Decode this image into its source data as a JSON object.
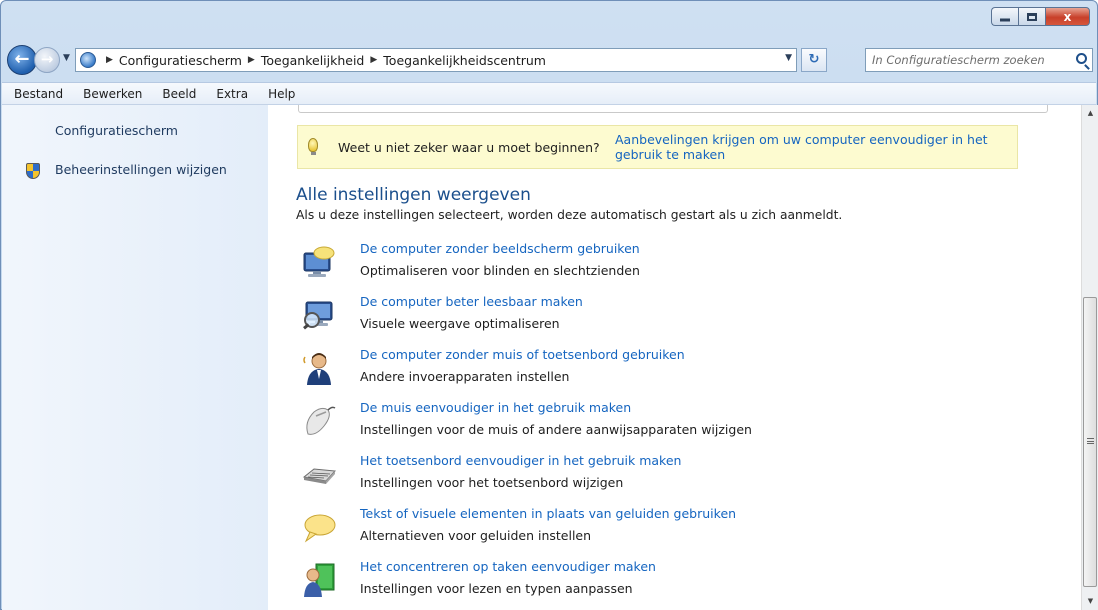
{
  "window": {
    "controls": {
      "minimize": "",
      "maximize": "",
      "close": "x"
    }
  },
  "navigation": {
    "back_glyph": "←",
    "forward_glyph": "→",
    "breadcrumbs": [
      "Configuratiescherm",
      "Toegankelijkheid",
      "Toegankelijkheidscentrum"
    ],
    "search_placeholder": "In Configuratiescherm zoeken"
  },
  "menubar": {
    "items": [
      "Bestand",
      "Bewerken",
      "Beeld",
      "Extra",
      "Help"
    ]
  },
  "sidebar": {
    "home_link": "Configuratiescherm",
    "admin_link": "Beheerinstellingen wijzigen"
  },
  "tip": {
    "question": "Weet u niet zeker waar u moet beginnen?",
    "link": "Aanbevelingen krijgen om uw computer eenvoudiger in het gebruik te maken"
  },
  "section": {
    "title": "Alle instellingen weergeven",
    "subtitle": "Als u deze instellingen selecteert, worden deze automatisch gestart als u zich aanmeldt."
  },
  "items": [
    {
      "title": "De computer zonder beeldscherm gebruiken",
      "desc": "Optimaliseren voor blinden en slechtzienden",
      "icon": "monitor-speech-icon"
    },
    {
      "title": "De computer beter leesbaar maken",
      "desc": "Visuele weergave optimaliseren",
      "icon": "monitor-magnifier-icon"
    },
    {
      "title": "De computer zonder muis of toetsenbord gebruiken",
      "desc": "Andere invoerapparaten instellen",
      "icon": "person-speech-icon"
    },
    {
      "title": "De muis eenvoudiger in het gebruik maken",
      "desc": "Instellingen voor de muis of andere aanwijsapparaten wijzigen",
      "icon": "mouse-icon"
    },
    {
      "title": "Het toetsenbord eenvoudiger in het gebruik maken",
      "desc": "Instellingen voor het toetsenbord wijzigen",
      "icon": "keyboard-icon"
    },
    {
      "title": "Tekst of visuele elementen in plaats van geluiden gebruiken",
      "desc": "Alternatieven voor geluiden instellen",
      "icon": "speech-bubble-icon"
    },
    {
      "title": "Het concentreren op taken eenvoudiger maken",
      "desc": "Instellingen voor lezen en typen aanpassen",
      "icon": "person-focus-icon"
    }
  ],
  "colors": {
    "link": "#1565c0",
    "section_title": "#1b4f8c",
    "tip_background": "#fdfbd0",
    "sidebar_background": "#e3edf9"
  }
}
